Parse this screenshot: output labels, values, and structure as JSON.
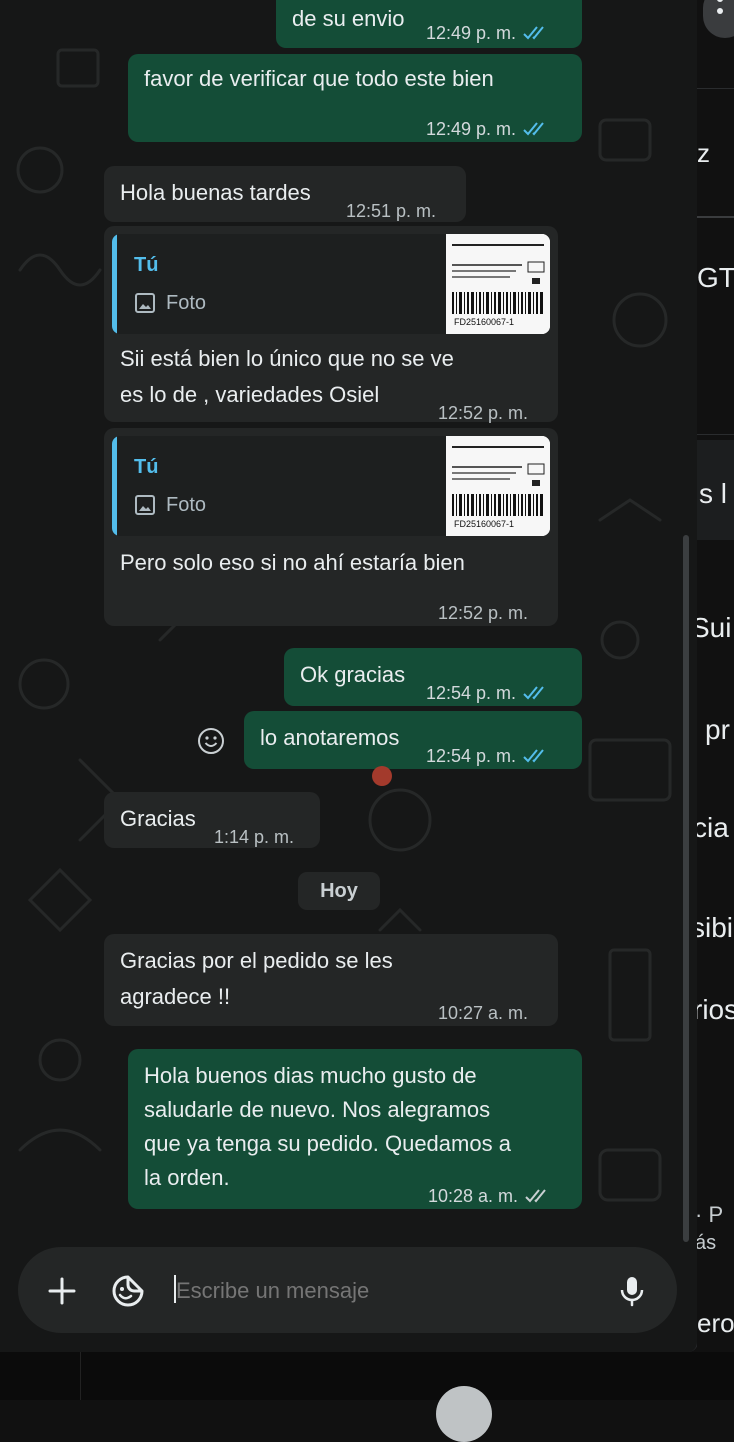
{
  "conversation": {
    "messages": [
      {
        "dir": "out",
        "text": "de su envio",
        "time": "12:49 p. m.",
        "ticks": "read"
      },
      {
        "dir": "out",
        "text": "favor de verificar que todo este bien",
        "time": "12:49 p. m.",
        "ticks": "read"
      },
      {
        "dir": "in",
        "text": "Hola buenas tardes",
        "time": "12:51 p. m."
      },
      {
        "dir": "in",
        "quote_author": "Tú",
        "quote_type": "Foto",
        "text_lines": [
          "Sii está bien lo único  que no se ve",
          "es lo de , variedades Osiel"
        ],
        "time": "12:52 p. m."
      },
      {
        "dir": "in",
        "quote_author": "Tú",
        "quote_type": "Foto",
        "text": "Pero solo eso si no ahí estaría bien",
        "time": "12:52 p. m."
      },
      {
        "dir": "out",
        "text": "Ok gracias",
        "time": "12:54 p. m.",
        "ticks": "read"
      },
      {
        "dir": "out",
        "text": "lo anotaremos",
        "time": "12:54 p. m.",
        "ticks": "read"
      },
      {
        "dir": "in",
        "text": "Gracias",
        "time": "1:14 p. m."
      },
      {
        "dir": "in",
        "text_lines": [
          "Gracias por el pedido se les",
          "agradece !!"
        ],
        "time": "10:27 a. m."
      },
      {
        "dir": "out",
        "text_lines": [
          "Hola buenos dias mucho gusto de",
          "saludarle de nuevo. Nos alegramos",
          "que ya tenga su pedido. Quedamos a",
          "la orden."
        ],
        "time": "10:28 a. m.",
        "ticks": "sent"
      }
    ],
    "day_separator": "Hoy",
    "thumbnail_text": "FD25160067-1"
  },
  "composer": {
    "placeholder": "Escribe un mensaje",
    "icons": [
      "plus-icon",
      "sticker-icon",
      "microphone-icon"
    ]
  },
  "right_panel": {
    "fragments": [
      "z",
      "GT",
      "s l",
      "Sui",
      "pr",
      "cia",
      "sibi",
      "rios",
      "· P",
      "ás",
      "ero"
    ]
  },
  "colors": {
    "outgoing_bubble": "#144d37",
    "incoming_bubble": "#242626",
    "read_tick": "#53bdeb",
    "background": "#161717"
  }
}
